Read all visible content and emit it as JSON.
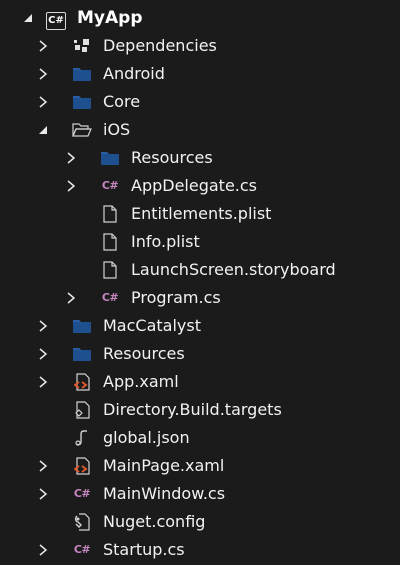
{
  "solution_explorer": {
    "root": {
      "label": "MyApp",
      "icon": "csharp-project-icon",
      "expanded": true
    },
    "items": [
      {
        "label": "Dependencies",
        "icon": "dependencies-icon",
        "expanded": false
      },
      {
        "label": "Android",
        "icon": "folder-icon",
        "expanded": false
      },
      {
        "label": "Core",
        "icon": "folder-icon",
        "expanded": false
      },
      {
        "label": "iOS",
        "icon": "open-folder-icon",
        "expanded": true
      },
      {
        "label": "Resources",
        "icon": "folder-icon",
        "expanded": false
      },
      {
        "label": "AppDelegate.cs",
        "icon": "csharp-file-icon",
        "expanded": false,
        "cs_glyph": "C#"
      },
      {
        "label": "Entitlements.plist",
        "icon": "file-icon"
      },
      {
        "label": "Info.plist",
        "icon": "file-icon"
      },
      {
        "label": "LaunchScreen.storyboard",
        "icon": "file-icon"
      },
      {
        "label": "Program.cs",
        "icon": "csharp-file-icon",
        "expanded": false,
        "cs_glyph": "C#"
      },
      {
        "label": "MacCatalyst",
        "icon": "folder-icon",
        "expanded": false
      },
      {
        "label": "Resources",
        "icon": "folder-icon",
        "expanded": false
      },
      {
        "label": "App.xaml",
        "icon": "xaml-file-icon",
        "expanded": false
      },
      {
        "label": "Directory.Build.targets",
        "icon": "targets-file-icon"
      },
      {
        "label": "global.json",
        "icon": "json-file-icon"
      },
      {
        "label": "MainPage.xaml",
        "icon": "xaml-file-icon",
        "expanded": false
      },
      {
        "label": "MainWindow.cs",
        "icon": "csharp-file-icon",
        "expanded": false,
        "cs_glyph": "C#"
      },
      {
        "label": "Nuget.config",
        "icon": "config-file-icon"
      },
      {
        "label": "Startup.cs",
        "icon": "csharp-file-icon",
        "expanded": false,
        "cs_glyph": "C#"
      }
    ],
    "root_glyph": "C#",
    "colors": {
      "background": "#1b1b1b",
      "folder": "#1e4f8f",
      "folder_tab": "#2a5fa6",
      "csharp": "#c586c0",
      "xaml": "#e05a2b",
      "text": "#f2f2f2"
    }
  }
}
